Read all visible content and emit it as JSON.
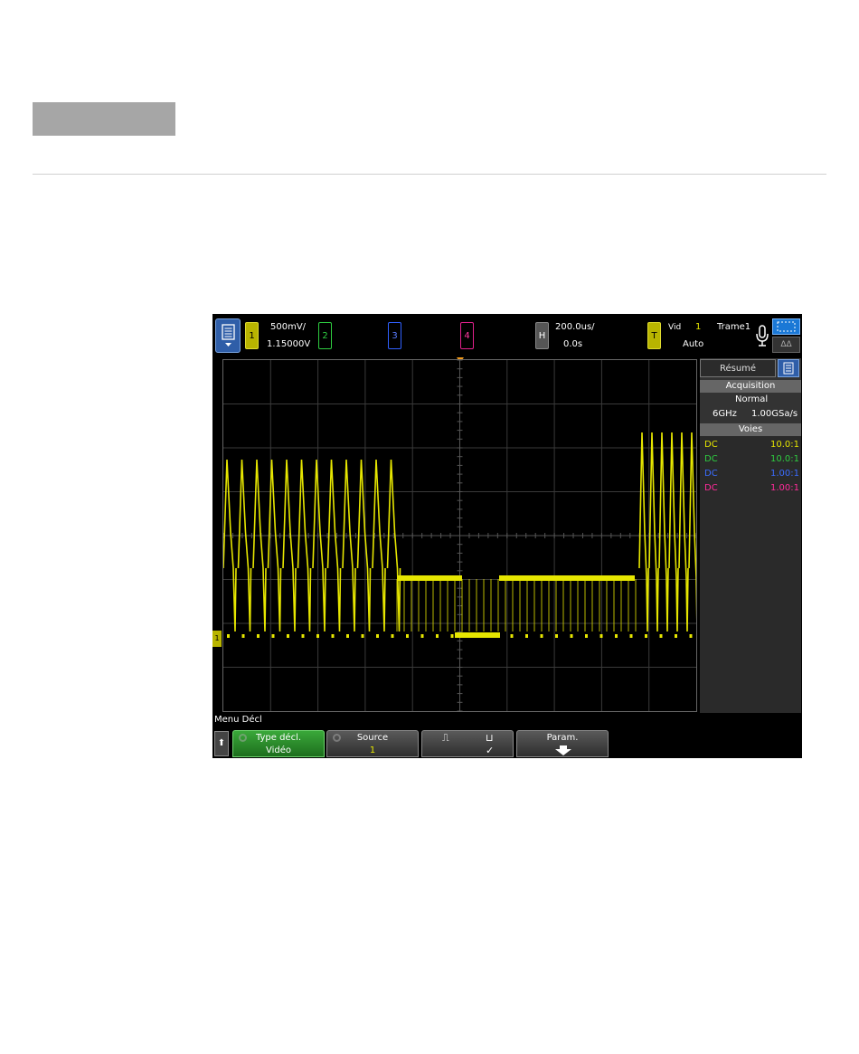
{
  "header": {
    "ch1": {
      "label": "1",
      "scale": "500mV/",
      "offset": "1.15000V"
    },
    "ch2": {
      "label": "2"
    },
    "ch3": {
      "label": "3"
    },
    "ch4": {
      "label": "4"
    },
    "horiz": {
      "label": "H",
      "scale": "200.0us/",
      "delay": "0.0s"
    },
    "trigger": {
      "label": "T",
      "type": "Vid",
      "source": "1",
      "field": "Trame1",
      "mode": "Auto"
    }
  },
  "panel": {
    "tab_label": "Résumé",
    "acquisition": {
      "title": "Acquisition",
      "mode": "Normal",
      "bandwidth": "6GHz",
      "rate": "1.00GSa/s"
    },
    "channels": {
      "title": "Voies",
      "rows": [
        {
          "coupling": "DC",
          "probe": "10.0:1",
          "color": "#e6e600"
        },
        {
          "coupling": "DC",
          "probe": "10.0:1",
          "color": "#2ecc40"
        },
        {
          "coupling": "DC",
          "probe": "1.00:1",
          "color": "#3a6cff"
        },
        {
          "coupling": "DC",
          "probe": "1.00:1",
          "color": "#ff2a9a"
        }
      ]
    }
  },
  "menu": {
    "title": "Menu Décl",
    "softkeys": {
      "trigger_type": {
        "label": "Type décl.",
        "value": "Vidéo"
      },
      "source": {
        "label": "Source",
        "value": "1"
      },
      "polarity": {
        "pos": "⎍",
        "neg": "⊔",
        "check": "✓"
      },
      "params": {
        "label": "Param."
      }
    }
  },
  "colors": {
    "ch1": "#e6e600",
    "accent": "#f29a1b"
  }
}
